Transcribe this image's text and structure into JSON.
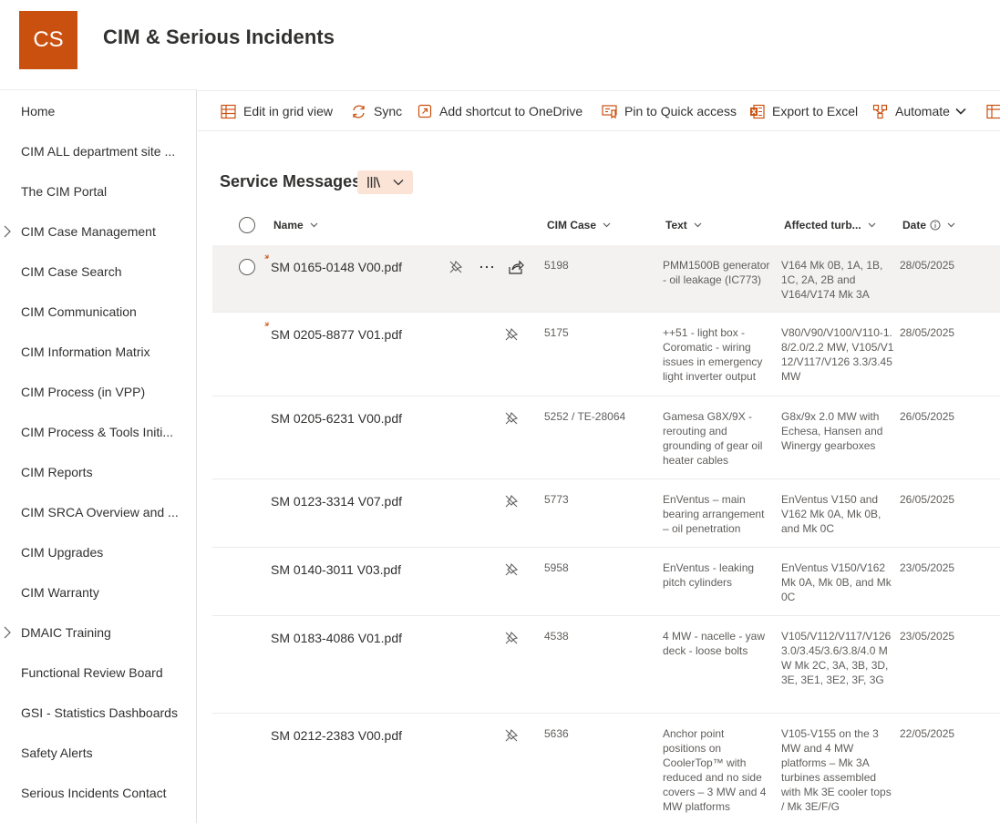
{
  "site": {
    "logo_text": "CS",
    "title": "CIM & Serious Incidents",
    "brand_color": "#ca5010"
  },
  "nav": {
    "items": [
      {
        "label": "Home",
        "expandable": false
      },
      {
        "label": "CIM ALL department site ...",
        "expandable": false
      },
      {
        "label": "The CIM Portal",
        "expandable": false
      },
      {
        "label": "CIM Case Management",
        "expandable": true
      },
      {
        "label": "CIM Case Search",
        "expandable": false
      },
      {
        "label": "CIM Communication",
        "expandable": false
      },
      {
        "label": "CIM Information Matrix",
        "expandable": false
      },
      {
        "label": "CIM Process (in VPP)",
        "expandable": false
      },
      {
        "label": "CIM Process & Tools Initi...",
        "expandable": false
      },
      {
        "label": "CIM Reports",
        "expandable": false
      },
      {
        "label": "CIM SRCA Overview and ...",
        "expandable": false
      },
      {
        "label": "CIM Upgrades",
        "expandable": false
      },
      {
        "label": "CIM Warranty",
        "expandable": false
      },
      {
        "label": "DMAIC Training",
        "expandable": true
      },
      {
        "label": "Functional Review Board",
        "expandable": false
      },
      {
        "label": "GSI - Statistics Dashboards",
        "expandable": false
      },
      {
        "label": "Safety Alerts",
        "expandable": false
      },
      {
        "label": "Serious Incidents Contact",
        "expandable": false
      }
    ]
  },
  "commands": {
    "edit_grid": "Edit in grid view",
    "sync": "Sync",
    "add_shortcut": "Add shortcut to OneDrive",
    "pin": "Pin to Quick access",
    "export": "Export to Excel",
    "automate": "Automate"
  },
  "view": {
    "title": "Service Messages"
  },
  "columns": {
    "name": "Name",
    "cim_case": "CIM Case",
    "text": "Text",
    "affected": "Affected turb...",
    "date": "Date"
  },
  "rows": [
    {
      "name": "SM 0165-0148 V00.pdf",
      "is_new": true,
      "selected": true,
      "cim_case": "5198",
      "text": "PMM1500B generator - oil leakage (IC773)",
      "affected": "V164 Mk 0B, 1A, 1B, 1C, 2A, 2B and V164/V174 Mk 3A",
      "date": "28/05/2025"
    },
    {
      "name": "SM 0205-8877 V01.pdf",
      "is_new": true,
      "selected": false,
      "cim_case": "5175",
      "text": "++51 - light box - Coromatic - wiring issues in emergency light inverter output",
      "affected": "V80/V90/V100/V110-1.8/2.0/2.2 MW, V105/V112/V117/V126 3.3/3.45 MW",
      "date": "28/05/2025"
    },
    {
      "name": "SM 0205-6231 V00.pdf",
      "is_new": false,
      "selected": false,
      "cim_case": "5252 / TE-28064",
      "text": "Gamesa G8X/9X - rerouting and grounding of gear oil heater cables",
      "affected": "G8x/9x 2.0 MW with Echesa, Hansen and Winergy gearboxes",
      "date": "26/05/2025"
    },
    {
      "name": "SM 0123-3314 V07.pdf",
      "is_new": false,
      "selected": false,
      "cim_case": "5773",
      "text": "EnVentus – main bearing arrangement – oil penetration",
      "affected": "EnVentus V150 and V162 Mk 0A, Mk 0B, and Mk 0C",
      "date": "26/05/2025"
    },
    {
      "name": "SM 0140-3011 V03.pdf",
      "is_new": false,
      "selected": false,
      "cim_case": "5958",
      "text": "EnVentus - leaking pitch cylinders",
      "affected": "EnVentus V150/V162 Mk 0A, Mk 0B, and Mk 0C",
      "date": "23/05/2025"
    },
    {
      "name": "SM 0183-4086 V01.pdf",
      "is_new": false,
      "selected": false,
      "cim_case": "4538",
      "text": "4 MW - nacelle - yaw deck - loose bolts",
      "affected": "V105/V112/V117/V126 3.0/3.45/3.6/3.8/4.0 MW Mk 2C, 3A, 3B, 3D, 3E, 3E1, 3E2, 3F, 3G",
      "date": "23/05/2025"
    },
    {
      "name": "SM 0212-2383 V00.pdf",
      "is_new": false,
      "selected": false,
      "cim_case": "5636",
      "text": "Anchor point positions on CoolerTop™ with reduced and no side covers – 3 MW and 4 MW platforms",
      "affected": "V105-V155 on the 3 MW and 4 MW platforms – Mk 3A turbines assembled with Mk 3E cooler tops / Mk 3E/F/G",
      "date": "22/05/2025"
    }
  ]
}
